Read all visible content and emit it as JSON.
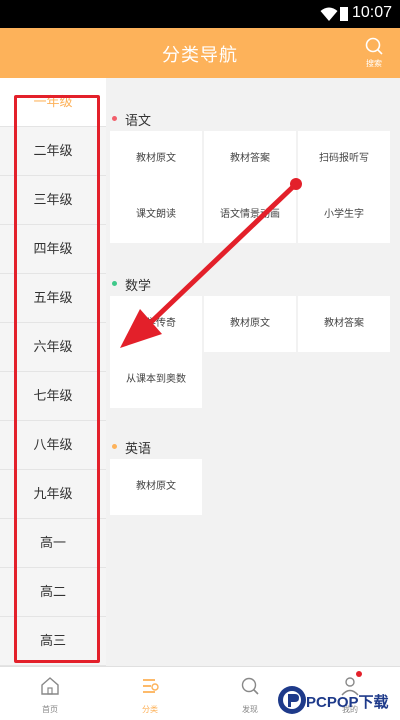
{
  "status_bar": {
    "time": "10:07"
  },
  "header": {
    "title": "分类导航",
    "search_label": "搜索"
  },
  "sidebar": {
    "items": [
      {
        "label": "一年级",
        "active": true
      },
      {
        "label": "二年级"
      },
      {
        "label": "三年级"
      },
      {
        "label": "四年级"
      },
      {
        "label": "五年级"
      },
      {
        "label": "六年级"
      },
      {
        "label": "七年级"
      },
      {
        "label": "八年级"
      },
      {
        "label": "九年级"
      },
      {
        "label": "高一"
      },
      {
        "label": "高二"
      },
      {
        "label": "高三"
      }
    ]
  },
  "sections": [
    {
      "title": "语文",
      "dot_color": "#f25f6b",
      "items": [
        "教材原文",
        "教材答案",
        "扫码报听写",
        "课文朗读",
        "语文情景动画",
        "小学生字"
      ]
    },
    {
      "title": "数学",
      "dot_color": "#3ec98a",
      "items": [
        "数学传奇",
        "教材原文",
        "教材答案",
        "从课本到奥数"
      ]
    },
    {
      "title": "英语",
      "dot_color": "#fdb25a",
      "items": [
        "教材原文"
      ]
    }
  ],
  "tabs": [
    {
      "label": "首页"
    },
    {
      "label": "分类",
      "active": true
    },
    {
      "label": "发现"
    },
    {
      "label": "我的"
    }
  ],
  "watermark": {
    "text": "PCPOP下载"
  },
  "colors": {
    "accent": "#fdb25a",
    "annotation": "#e3202a"
  }
}
